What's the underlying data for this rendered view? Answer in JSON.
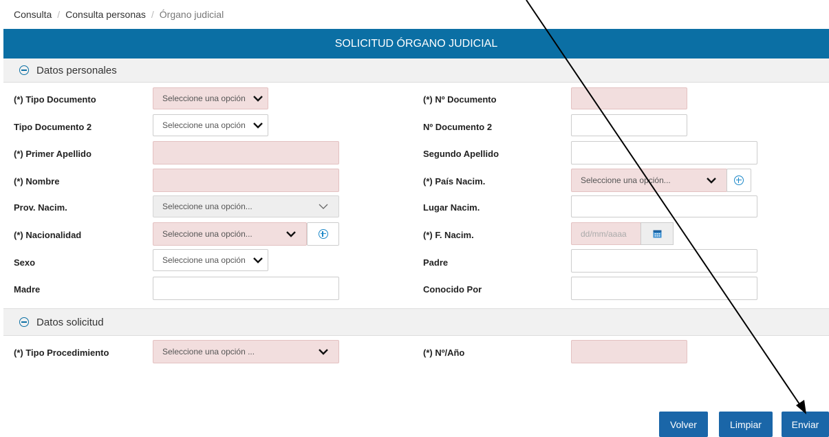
{
  "breadcrumb": {
    "items": [
      "Consulta",
      "Consulta personas",
      "Órgano judicial"
    ],
    "separator": "/"
  },
  "title": "SOLICITUD ÓRGANO JUDICIAL",
  "sections": {
    "personal": "Datos personales",
    "solicitud": "Datos solicitud"
  },
  "fields": {
    "tipo_documento": {
      "label": "(*) Tipo Documento",
      "value": "Seleccione una opción"
    },
    "n_documento": {
      "label": "(*) Nº Documento",
      "value": ""
    },
    "tipo_documento_2": {
      "label": "Tipo Documento 2",
      "value": "Seleccione una opción"
    },
    "n_documento_2": {
      "label": "Nº Documento 2",
      "value": ""
    },
    "primer_apellido": {
      "label": "(*) Primer Apellido",
      "value": ""
    },
    "segundo_apellido": {
      "label": "Segundo Apellido",
      "value": ""
    },
    "nombre": {
      "label": "(*) Nombre",
      "value": ""
    },
    "pais_nacim": {
      "label": "(*) País Nacim.",
      "value": "Seleccione una opción..."
    },
    "prov_nacim": {
      "label": "Prov. Nacim.",
      "value": "Seleccione una opción..."
    },
    "lugar_nacim": {
      "label": "Lugar Nacim.",
      "value": ""
    },
    "nacionalidad": {
      "label": "(*) Nacionalidad",
      "value": "Seleccione una opción..."
    },
    "f_nacim": {
      "label": "(*) F. Nacim.",
      "placeholder": "dd/mm/aaaa"
    },
    "sexo": {
      "label": "Sexo",
      "value": "Seleccione una opción"
    },
    "padre": {
      "label": "Padre",
      "value": ""
    },
    "madre": {
      "label": "Madre",
      "value": ""
    },
    "conocido_por": {
      "label": "Conocido Por",
      "value": ""
    },
    "tipo_procedimiento": {
      "label": "(*) Tipo Procedimiento",
      "value": "Seleccione una opción ..."
    },
    "n_anio": {
      "label": "(*) Nº/Año",
      "value": ""
    }
  },
  "buttons": {
    "volver": "Volver",
    "limpiar": "Limpiar",
    "enviar": "Enviar"
  },
  "colors": {
    "header": "#0b6fa4",
    "required_field": "#f2dede",
    "button": "#1a66a8"
  }
}
